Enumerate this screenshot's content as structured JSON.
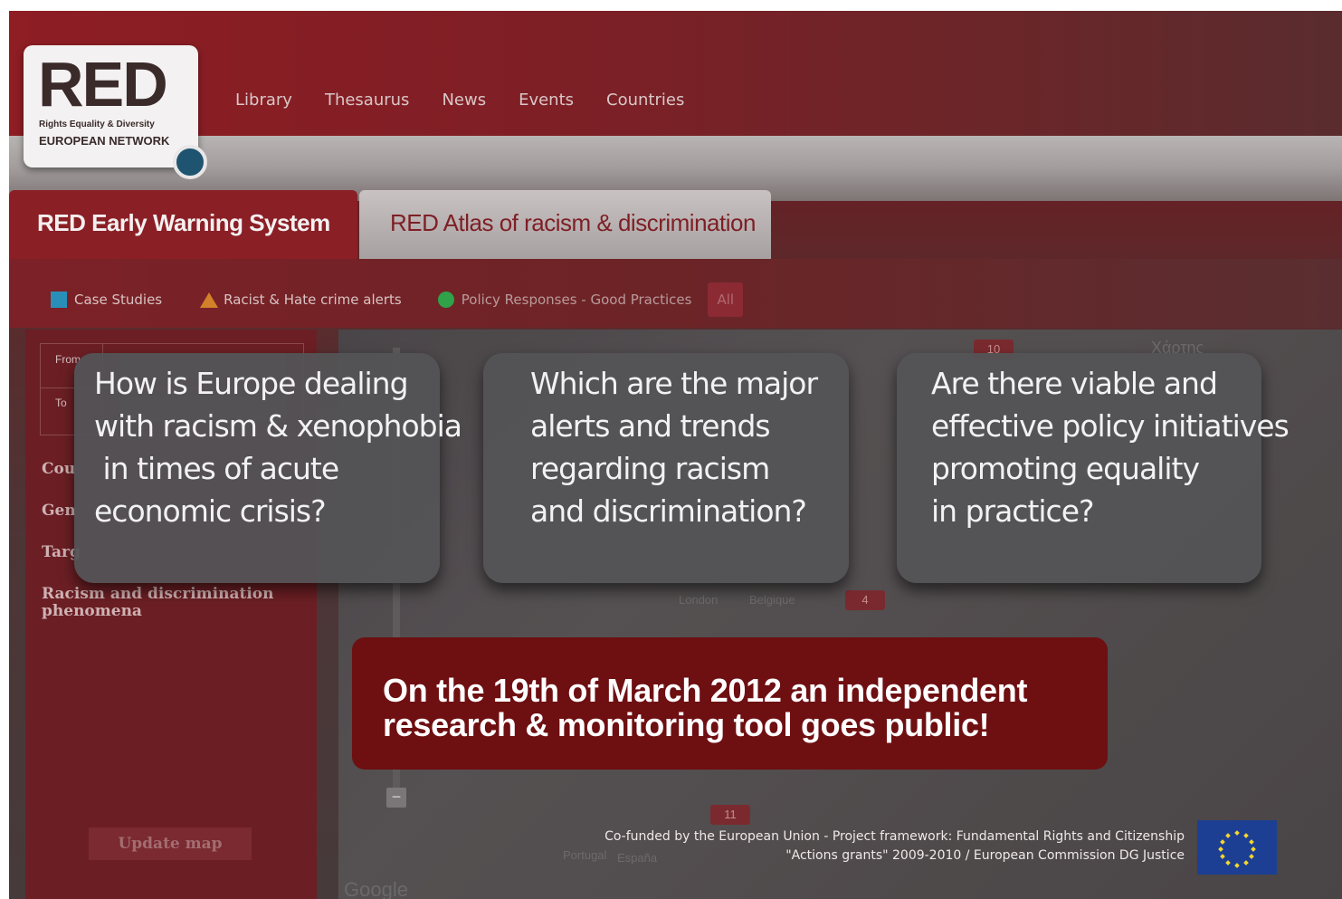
{
  "header": {
    "logo": {
      "title": "RED",
      "line1": "Rights Equality & Diversity",
      "line2": "EUROPEAN NETWORK"
    },
    "nav": [
      "Library",
      "Thesaurus",
      "News",
      "Events",
      "Countries"
    ]
  },
  "tabs": {
    "active": "RED Early Warning System",
    "inactive": "RED Atlas of racism & discrimination"
  },
  "legend": {
    "case_studies": "Case Studies",
    "alerts": "Racist & Hate crime alerts",
    "policy": "Policy Responses - Good Practices",
    "all": "All"
  },
  "sidebar": {
    "from_label": "From",
    "to_label": "To",
    "filters": [
      "Cou",
      "Gen",
      "Targ",
      "Racism and discrimination",
      "phenomena"
    ],
    "update_button": "Update map"
  },
  "map": {
    "clusters": [
      "10",
      "4",
      "11"
    ],
    "labels": {
      "top_right": "Χάρτης",
      "belgique": "Belgique",
      "portugal": "Portugal",
      "espana": "España",
      "london": "London",
      "google": "Google"
    }
  },
  "cards": [
    {
      "lines": [
        "How is Europe dealing",
        "with racism & xenophobia",
        " in times of acute",
        "economic crisis?"
      ]
    },
    {
      "lines": [
        "Which are the major",
        "alerts and trends",
        "regarding racism",
        "and discrimination?"
      ]
    },
    {
      "lines": [
        "Are there viable and",
        "effective policy initiatives",
        "promoting equality",
        "in practice?"
      ]
    }
  ],
  "banner": {
    "line1": "On the 19th of March 2012 an independent",
    "line2": "research & monitoring tool goes public!"
  },
  "footer": {
    "line1": "Co-funded by the European Union - Project framework: Fundamental Rights and Citizenship",
    "line2": "\"Actions grants\" 2009-2010 / European Commission DG Justice"
  },
  "colors": {
    "brand_red": "#8a1f26",
    "banner_red": "#6e0f12",
    "eu_blue": "#1c3f94",
    "eu_star": "#f5d530"
  }
}
